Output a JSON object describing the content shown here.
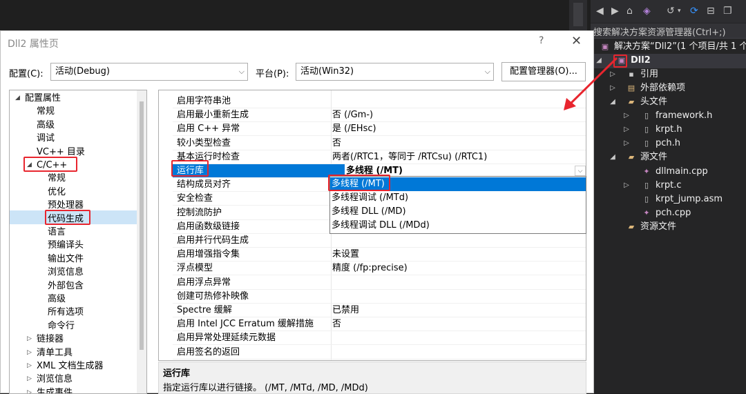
{
  "dialog": {
    "title": "Dll2 属性页",
    "help": "?",
    "close": "✕",
    "config_label": "配置(C):",
    "config_value": "活动(Debug)",
    "platform_label": "平台(P):",
    "platform_value": "活动(Win32)",
    "config_manager": "配置管理器(O)..."
  },
  "tree": [
    {
      "label": "配置属性",
      "twisty": "◢",
      "level": 0
    },
    {
      "label": "常规",
      "level": 1
    },
    {
      "label": "高级",
      "level": 1
    },
    {
      "label": "调试",
      "level": 1
    },
    {
      "label": "VC++ 目录",
      "level": 1
    },
    {
      "label": "C/C++",
      "twisty": "◢",
      "level": 1
    },
    {
      "label": "常规",
      "level": 2
    },
    {
      "label": "优化",
      "level": 2
    },
    {
      "label": "预处理器",
      "level": 2
    },
    {
      "label": "代码生成",
      "level": 2,
      "selected": true
    },
    {
      "label": "语言",
      "level": 2
    },
    {
      "label": "预编译头",
      "level": 2
    },
    {
      "label": "输出文件",
      "level": 2
    },
    {
      "label": "浏览信息",
      "level": 2
    },
    {
      "label": "外部包含",
      "level": 2
    },
    {
      "label": "高级",
      "level": 2
    },
    {
      "label": "所有选项",
      "level": 2
    },
    {
      "label": "命令行",
      "level": 2
    },
    {
      "label": "链接器",
      "twisty": "▷",
      "level": 1
    },
    {
      "label": "清单工具",
      "twisty": "▷",
      "level": 1
    },
    {
      "label": "XML 文档生成器",
      "twisty": "▷",
      "level": 1
    },
    {
      "label": "浏览信息",
      "twisty": "▷",
      "level": 1
    },
    {
      "label": "生成事件",
      "twisty": "▷",
      "level": 1
    }
  ],
  "properties": [
    {
      "name": "启用字符串池",
      "value": ""
    },
    {
      "name": "启用最小重新生成",
      "value": "否 (/Gm-)"
    },
    {
      "name": "启用 C++ 异常",
      "value": "是 (/EHsc)"
    },
    {
      "name": "较小类型检查",
      "value": "否"
    },
    {
      "name": "基本运行时检查",
      "value": "两者(/RTC1，等同于 /RTCsu) (/RTC1)"
    },
    {
      "name": "运行库",
      "value": "多线程 (/MT)",
      "selected": true
    },
    {
      "name": "结构成员对齐",
      "value": ""
    },
    {
      "name": "安全检查",
      "value": ""
    },
    {
      "name": "控制流防护",
      "value": ""
    },
    {
      "name": "启用函数级链接",
      "value": ""
    },
    {
      "name": "启用并行代码生成",
      "value": ""
    },
    {
      "name": "启用增强指令集",
      "value": "未设置"
    },
    {
      "name": "浮点模型",
      "value": "精度 (/fp:precise)"
    },
    {
      "name": "启用浮点异常",
      "value": ""
    },
    {
      "name": "创建可热修补映像",
      "value": ""
    },
    {
      "name": "Spectre 缓解",
      "value": "已禁用"
    },
    {
      "name": "启用 Intel JCC Erratum 缓解措施",
      "value": "否"
    },
    {
      "name": "启用异常处理延续元数据",
      "value": ""
    },
    {
      "name": "启用签名的返回",
      "value": ""
    }
  ],
  "dropdown_options": [
    "多线程 (/MT)",
    "多线程调试 (/MTd)",
    "多线程 DLL (/MD)",
    "多线程调试 DLL (/MDd)"
  ],
  "description": {
    "title": "运行库",
    "text": "指定运行库以进行链接。    (/MT, /MTd, /MD, /MDd)"
  },
  "solution_explorer": {
    "search_placeholder": "搜索解决方案资源管理器(Ctrl+;)",
    "solution_label": "解决方案“Dll2”(1 个项目/共 1 个",
    "items": [
      {
        "label": "Dll2",
        "icon": "project-icon",
        "bold": true
      },
      {
        "label": "引用",
        "icon": "references-icon"
      },
      {
        "label": "外部依赖项",
        "icon": "external-deps-icon"
      },
      {
        "label": "头文件",
        "icon": "folder-icon"
      },
      {
        "label": "framework.h",
        "icon": "header-file-icon"
      },
      {
        "label": "krpt.h",
        "icon": "header-file-icon"
      },
      {
        "label": "pch.h",
        "icon": "header-file-icon"
      },
      {
        "label": "源文件",
        "icon": "folder-icon"
      },
      {
        "label": "dllmain.cpp",
        "icon": "cpp-file-icon"
      },
      {
        "label": "krpt.c",
        "icon": "c-file-icon"
      },
      {
        "label": "krpt_jump.asm",
        "icon": "asm-file-icon"
      },
      {
        "label": "pch.cpp",
        "icon": "cpp-file-icon"
      },
      {
        "label": "资源文件",
        "icon": "folder-icon"
      }
    ]
  },
  "colors": {
    "accent": "#0078d7",
    "highlight": "#e8252e",
    "dark_bg": "#252526"
  }
}
